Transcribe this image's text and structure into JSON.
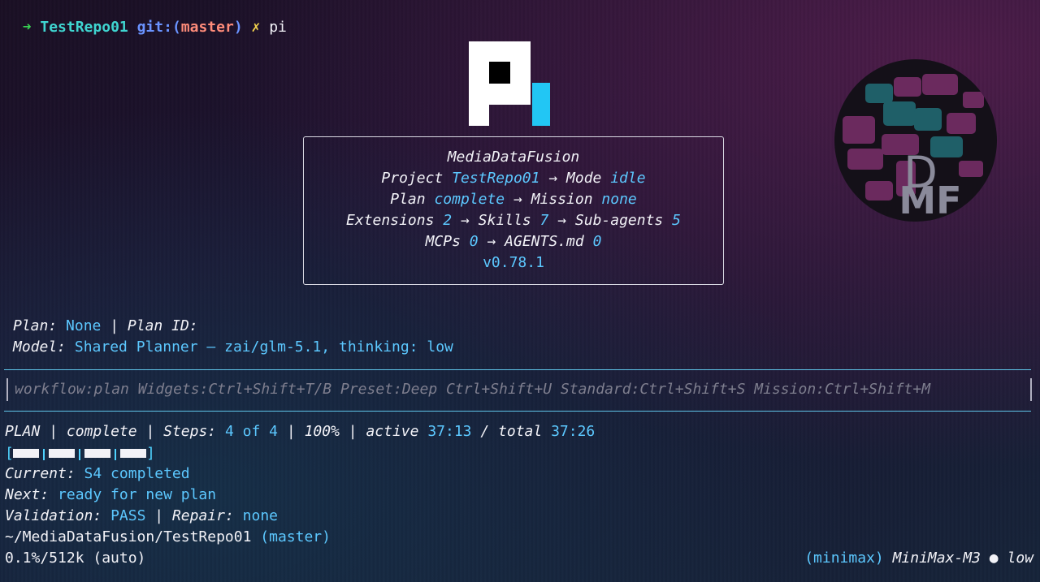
{
  "prompt": {
    "arrow": "➜",
    "dir": "TestRepo01",
    "git_label": "git:(",
    "branch": "master",
    "git_close": ")",
    "dirty": "✗",
    "command": "pi"
  },
  "logo": {
    "name": "pi-logo",
    "colors": {
      "white": "#ffffff",
      "accent": "#22c6f4"
    }
  },
  "info": {
    "project_name": "MediaDataFusion",
    "project_label": "Project",
    "project_value": "TestRepo01",
    "mode_label": "Mode",
    "mode_value": "idle",
    "plan_label": "Plan",
    "plan_value": "complete",
    "mission_label": "Mission",
    "mission_value": "none",
    "extensions_label": "Extensions",
    "extensions_value": "2",
    "skills_label": "Skills",
    "skills_value": "7",
    "subagents_label": "Sub-agents",
    "subagents_value": "5",
    "mcps_label": "MCPs",
    "mcps_value": "0",
    "agents_label": "AGENTS.md",
    "agents_value": "0",
    "arrow": "→",
    "version": "v0.78.1"
  },
  "plan_line": {
    "plan_label": "Plan:",
    "plan_value": "None",
    "sep": "|",
    "plan_id_label": "Plan ID:"
  },
  "model_line": {
    "label": "Model:",
    "value": "Shared Planner – zai/glm-5.1, thinking: low"
  },
  "input": {
    "placeholder": "workflow:plan Widgets:Ctrl+Shift+T/B Preset:Deep Ctrl+Shift+U Standard:Ctrl+Shift+S Mission:Ctrl+Shift+M"
  },
  "status": {
    "plan_word": "PLAN",
    "sep": "|",
    "state": "complete",
    "steps_label": "Steps:",
    "steps_value": "4 of 4",
    "percent": "100%",
    "active_label": "active",
    "active_value": "37:13",
    "slash": "/",
    "total_label": "total",
    "total_value": "37:26",
    "progress_fraction": 1.0,
    "progress_segments": 4,
    "bracket_open": "[",
    "bracket_close": "]",
    "current_label": "Current:",
    "current_value": "S4 completed",
    "next_label": "Next:",
    "next_value": "ready for new plan",
    "validation_label": "Validation:",
    "validation_value": "PASS",
    "repair_label": "Repair:",
    "repair_value": "none",
    "path": "~/MediaDataFusion/TestRepo01",
    "path_branch": "(master)",
    "context": "0.1%/512k (auto)",
    "provider": "(minimax)",
    "model": "MiniMax-M3",
    "dot": "●",
    "thinking": "low"
  },
  "badge": {
    "name": "dmf-badge",
    "letters_top": "D",
    "letters_bottom": "MF",
    "colors": {
      "bg": "#141018",
      "magenta": "#6b2a5e",
      "teal": "#1f5f68",
      "letters": "#8a8a9a"
    }
  }
}
